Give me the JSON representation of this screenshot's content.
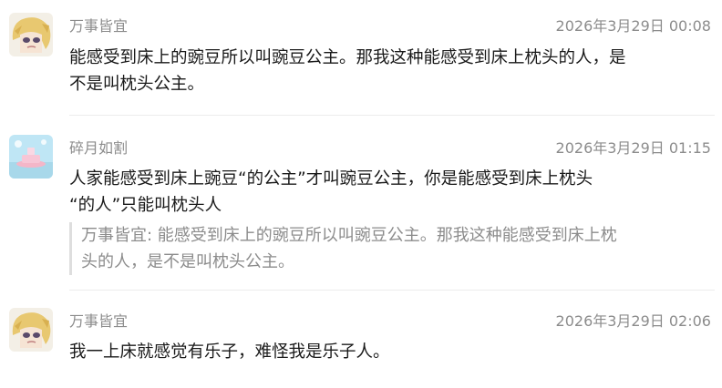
{
  "comments": [
    {
      "username": "万事皆宜",
      "time": "2026年3月29日 00:08",
      "line1": "能感受到床上的豌豆所以叫豌豆公主。那我这种能感受到床上枕头的人，是",
      "line2": "不是叫枕头公主。",
      "avatar": "anime-girl-avatar"
    },
    {
      "username": "碎月如割",
      "time": "2026年3月29日 01:15",
      "line1": "人家能感受到床上豌豆“的公主”才叫豌豆公主，你是能感受到床上枕头",
      "line2": "“的人”只能叫枕头人",
      "avatar": "pink-ship-avatar",
      "quote_line1": "万事皆宜: 能感受到床上的豌豆所以叫豌豆公主。那我这种能感受到床上枕",
      "quote_line2": "头的人，是不是叫枕头公主。"
    },
    {
      "username": "万事皆宜",
      "time": "2026年3月29日 02:06",
      "line1": "我一上床就感觉有乐子，难怪我是乐子人。",
      "avatar": "anime-girl-avatar"
    }
  ],
  "colors": {
    "meta_text": "#8c8c8c",
    "body_text": "#1a1a1a",
    "divider": "#ececec",
    "quote_bar": "#dedede"
  }
}
